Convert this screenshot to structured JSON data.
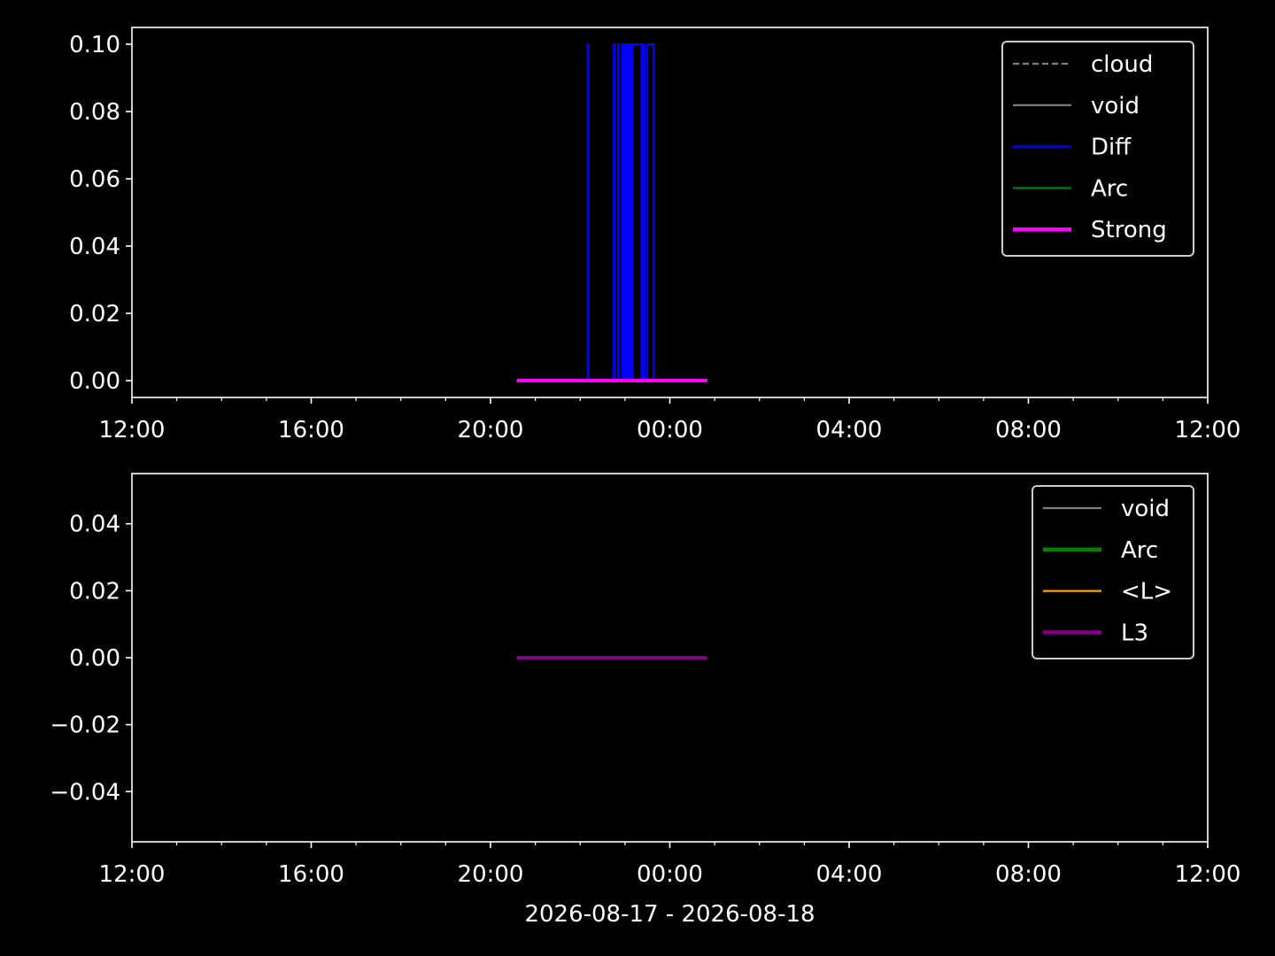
{
  "figure": {
    "background": "#000000",
    "foreground": "#ffffff"
  },
  "chart_data": [
    {
      "type": "line",
      "xlabel": "",
      "ylabel": "",
      "xlim": [
        "2026-08-17 12:00",
        "2026-08-18 12:00"
      ],
      "ylim": [
        -0.005,
        0.105
      ],
      "x_ticks": [
        "12:00",
        "16:00",
        "20:00",
        "00:00",
        "04:00",
        "08:00",
        "12:00"
      ],
      "y_ticks": [
        "0.00",
        "0.02",
        "0.04",
        "0.06",
        "0.08",
        "0.10"
      ],
      "grid": false,
      "legend_position": "top-right",
      "legend": [
        {
          "label": "cloud",
          "color": "#808080",
          "style": "dashed"
        },
        {
          "label": "void",
          "color": "#808080",
          "style": "solid"
        },
        {
          "label": "Diff",
          "color": "#0000ff",
          "style": "solid"
        },
        {
          "label": "Arc",
          "color": "#008000",
          "style": "solid"
        },
        {
          "label": "Strong",
          "color": "#ff00ff",
          "style": "solid-thick"
        }
      ],
      "series": [
        {
          "name": "Diff",
          "color": "#0000ff",
          "points": [
            [
              "2026-08-17 22:10",
              0
            ],
            [
              "2026-08-17 22:10",
              0.1
            ],
            [
              "2026-08-17 22:11",
              0.1
            ],
            [
              "2026-08-17 22:11",
              0
            ],
            [
              "2026-08-17 22:45",
              0
            ],
            [
              "2026-08-17 22:45",
              0.1
            ],
            [
              "2026-08-17 22:46",
              0.1
            ],
            [
              "2026-08-17 22:46",
              0
            ],
            [
              "2026-08-17 22:51",
              0
            ],
            [
              "2026-08-17 22:51",
              0.1
            ],
            [
              "2026-08-17 22:52",
              0.1
            ],
            [
              "2026-08-17 22:52",
              0
            ],
            [
              "2026-08-17 22:56",
              0
            ],
            [
              "2026-08-17 22:56",
              0.1
            ],
            [
              "2026-08-17 22:58",
              0.1
            ],
            [
              "2026-08-17 22:58",
              0
            ],
            [
              "2026-08-17 23:00",
              0
            ],
            [
              "2026-08-17 23:00",
              0.1
            ],
            [
              "2026-08-17 23:02",
              0.1
            ],
            [
              "2026-08-17 23:02",
              0
            ],
            [
              "2026-08-17 23:03",
              0
            ],
            [
              "2026-08-17 23:03",
              0.1
            ],
            [
              "2026-08-17 23:05",
              0.1
            ],
            [
              "2026-08-17 23:05",
              0
            ],
            [
              "2026-08-17 23:06",
              0
            ],
            [
              "2026-08-17 23:06",
              0.1
            ],
            [
              "2026-08-17 23:08",
              0.1
            ],
            [
              "2026-08-17 23:08",
              0
            ],
            [
              "2026-08-17 23:10",
              0
            ],
            [
              "2026-08-17 23:10",
              0.1
            ],
            [
              "2026-08-17 23:22",
              0.1
            ],
            [
              "2026-08-17 23:22",
              0
            ],
            [
              "2026-08-17 23:24",
              0
            ],
            [
              "2026-08-17 23:24",
              0.1
            ],
            [
              "2026-08-17 23:26",
              0.1
            ],
            [
              "2026-08-17 23:26",
              0
            ],
            [
              "2026-08-17 23:30",
              0
            ],
            [
              "2026-08-17 23:30",
              0.1
            ],
            [
              "2026-08-17 23:38",
              0.1
            ],
            [
              "2026-08-17 23:38",
              0
            ]
          ]
        },
        {
          "name": "Strong",
          "color": "#ff00ff",
          "points": [
            [
              "2026-08-17 20:35",
              0
            ],
            [
              "2026-08-18 00:50",
              0
            ]
          ]
        }
      ]
    },
    {
      "type": "line",
      "xlabel": "2026-08-17 - 2026-08-18",
      "ylabel": "",
      "xlim": [
        "2026-08-17 12:00",
        "2026-08-18 12:00"
      ],
      "ylim": [
        -0.055,
        0.055
      ],
      "x_ticks": [
        "12:00",
        "16:00",
        "20:00",
        "00:00",
        "04:00",
        "08:00",
        "12:00"
      ],
      "y_ticks": [
        "−0.04",
        "−0.02",
        "0.00",
        "0.02",
        "0.04"
      ],
      "grid": false,
      "legend_position": "top-right",
      "legend": [
        {
          "label": "void",
          "color": "#808080",
          "style": "solid"
        },
        {
          "label": "Arc",
          "color": "#008000",
          "style": "solid-thick"
        },
        {
          "label": "<L>",
          "color": "#ffa500",
          "style": "solid"
        },
        {
          "label": "L3",
          "color": "#800080",
          "style": "solid-thick"
        }
      ],
      "series": [
        {
          "name": "L3",
          "color": "#800080",
          "points": [
            [
              "2026-08-17 20:35",
              0
            ],
            [
              "2026-08-18 00:50",
              0
            ]
          ]
        }
      ]
    }
  ]
}
